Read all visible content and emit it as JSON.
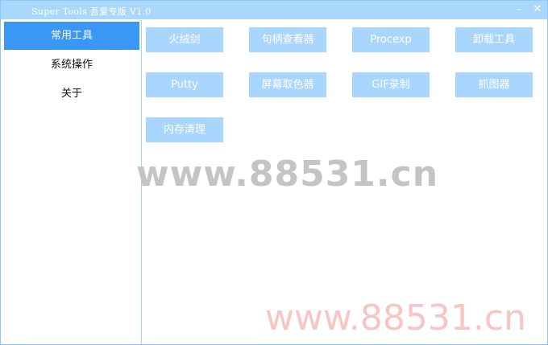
{
  "window": {
    "title": "Super Tools 吾爱专版 V1.0",
    "minimize_label": "–",
    "close_label": "✕"
  },
  "sidebar": {
    "items": [
      {
        "label": "常用工具",
        "active": true
      },
      {
        "label": "系统操作",
        "active": false
      },
      {
        "label": "关于",
        "active": false
      }
    ]
  },
  "tools": [
    {
      "label": "火绒剑"
    },
    {
      "label": "句柄查看器"
    },
    {
      "label": "Procexp"
    },
    {
      "label": "卸载工具"
    },
    {
      "label": "Putty"
    },
    {
      "label": "屏幕取色器"
    },
    {
      "label": "GIF录制"
    },
    {
      "label": "抓图器"
    },
    {
      "label": "内存清理"
    }
  ],
  "watermarks": {
    "center": "www.88531.cn",
    "bottom": "www.88531.cn"
  },
  "colors": {
    "titlebar": "#a9d8fc",
    "active_item": "#3b97f5",
    "tool_button": "#a9d6fd",
    "watermark_gray": "#c4c4c4",
    "watermark_red": "#f7c6c2"
  }
}
